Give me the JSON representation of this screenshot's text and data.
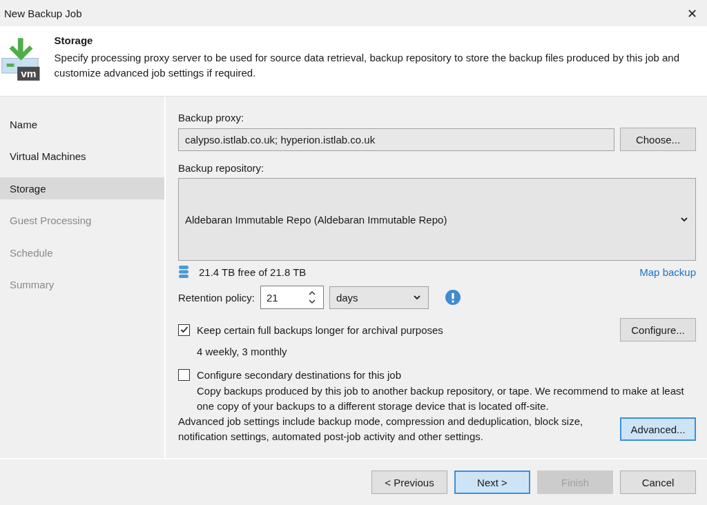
{
  "window": {
    "title": "New Backup Job",
    "close": "✕"
  },
  "header": {
    "title": "Storage",
    "description": "Specify processing proxy server to be used for source data retrieval, backup repository to store the backup files produced by this job and customize advanced job settings if required.",
    "logo_text": "vm"
  },
  "steps": [
    {
      "label": "Name",
      "selected": false,
      "disabled": false
    },
    {
      "label": "Virtual Machines",
      "selected": false,
      "disabled": false
    },
    {
      "label": "Storage",
      "selected": true,
      "disabled": false
    },
    {
      "label": "Guest Processing",
      "selected": false,
      "disabled": true
    },
    {
      "label": "Schedule",
      "selected": false,
      "disabled": true
    },
    {
      "label": "Summary",
      "selected": false,
      "disabled": true
    }
  ],
  "proxy": {
    "label": "Backup proxy:",
    "value": "calypso.istlab.co.uk; hyperion.istlab.co.uk",
    "button": "Choose..."
  },
  "repository": {
    "label": "Backup repository:",
    "value": "Aldebaran Immutable Repo (Aldebaran Immutable Repo)",
    "free_space": "21.4 TB free of 21.8 TB",
    "link": "Map backup"
  },
  "retention": {
    "label": "Retention policy:",
    "value": "21",
    "unit": "days"
  },
  "archival": {
    "label": "Keep certain full backups longer for archival purposes",
    "checked": true,
    "summary": "4 weekly, 3 monthly",
    "button": "Configure..."
  },
  "secondary": {
    "label": "Configure secondary destinations for this job",
    "checked": false,
    "description": "Copy backups produced by this job to another backup repository, or tape. We recommend to make at least one copy of your backups to a different storage device that is located off-site."
  },
  "advanced": {
    "description": "Advanced job settings include backup mode, compression and deduplication, block size, notification settings, automated post-job activity and other settings.",
    "button": "Advanced..."
  },
  "buttons": [
    {
      "label": "< Previous",
      "default": false,
      "disabled": false
    },
    {
      "label": "Next >",
      "default": true,
      "disabled": false
    },
    {
      "label": "Finish",
      "default": false,
      "disabled": true
    },
    {
      "label": "Cancel",
      "default": false,
      "disabled": false
    }
  ]
}
